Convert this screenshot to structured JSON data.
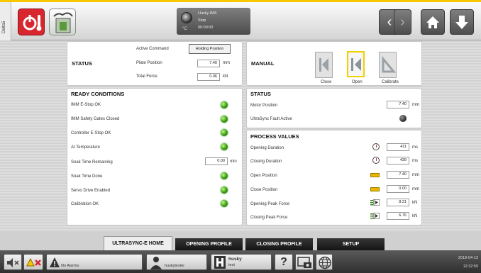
{
  "header": {
    "side_tab": "Delta5",
    "status": {
      "machine": "Husky IMS",
      "state": "Stop",
      "timer": "00:00:00",
      "temp_unit": "°C"
    },
    "nav": {
      "back_icon": "chevron-left-icon",
      "forward_icon": "chevron-right-icon",
      "home_icon": "home-icon",
      "download_icon": "arrow-down-icon"
    }
  },
  "status_panel": {
    "title": "STATUS",
    "active_command_label": "Active Command",
    "active_command_value": "Holding Position",
    "plate_position_label": "Plate Position",
    "plate_position_value": "7.40",
    "plate_position_unit": "mm",
    "total_force_label": "Total Force",
    "total_force_value": "0.06",
    "total_force_unit": "kN"
  },
  "manual_panel": {
    "title": "MANUAL",
    "buttons": [
      {
        "label": "Close",
        "icon": "close-plate-icon",
        "active": false
      },
      {
        "label": "Open",
        "icon": "open-plate-icon",
        "active": true
      },
      {
        "label": "Calibrate",
        "icon": "calibrate-icon",
        "active": false
      }
    ]
  },
  "ready_conditions": {
    "title": "READY CONDITIONS",
    "items": [
      {
        "label": "IMM E-Stop OK",
        "led": "green"
      },
      {
        "label": "IMM Safety Gates Closed",
        "led": "green"
      },
      {
        "label": "Controller E-Stop OK",
        "led": "green"
      },
      {
        "label": "At Temperature",
        "led": "green"
      },
      {
        "label": "Soak Time Remaining",
        "value": "0.00",
        "unit": "min"
      },
      {
        "label": "Soak Time Done",
        "led": "green"
      },
      {
        "label": "Servo Drive Enabled",
        "led": "green"
      },
      {
        "label": "Calibration OK",
        "led": "green"
      }
    ]
  },
  "status2": {
    "title": "STATUS",
    "motor_position_label": "Motor Position",
    "motor_position_value": "7.40",
    "motor_position_unit": "mm",
    "fault_label": "UltraSync Fault Active",
    "fault_led": "off"
  },
  "process_values": {
    "title": "PROCESS VALUES",
    "items": [
      {
        "label": "Opening Duration",
        "icon": "stopwatch-icon",
        "value": "411",
        "unit": "ms"
      },
      {
        "label": "Closing Duration",
        "icon": "stopwatch-icon",
        "value": "439",
        "unit": "ms"
      },
      {
        "label": "Open Position",
        "icon": "ruler-icon",
        "value": "7.40",
        "unit": "mm"
      },
      {
        "label": "Close Position",
        "icon": "ruler-icon",
        "value": "0.00",
        "unit": "mm"
      },
      {
        "label": "Opening Peak Force",
        "icon": "force-icon",
        "value": "8.21",
        "unit": "kN"
      },
      {
        "label": "Closing Peak Force",
        "icon": "force-icon",
        "value": "6.76",
        "unit": "kN"
      }
    ]
  },
  "tabs": [
    {
      "label": "ULTRASYNC-E HOME",
      "active": true
    },
    {
      "label": "OPENING PROFILE",
      "active": false
    },
    {
      "label": "CLOSING PROFILE",
      "active": false
    },
    {
      "label": "SETUP",
      "active": false
    }
  ],
  "bottom_bar": {
    "alarms_label": "No Alarms",
    "user": "huskytester",
    "machine_name": "husky",
    "machine_sub": "test",
    "help": "?",
    "date": "2018-04-13",
    "time": "12:32:59"
  },
  "colors": {
    "accent_yellow": "#f5c800",
    "alarm_red": "#d8262f",
    "led_green": "#3a9a10",
    "tab_dark": "#1e1e1e"
  }
}
